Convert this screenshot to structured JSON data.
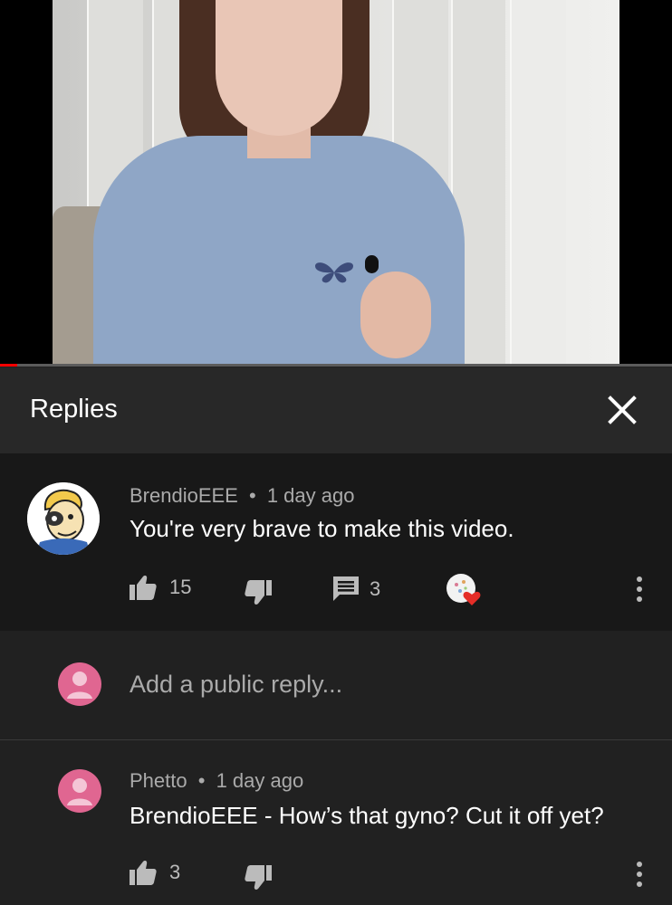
{
  "video": {
    "progress_fraction": 0.025
  },
  "replies_panel": {
    "title": "Replies",
    "close_icon": "close-icon"
  },
  "comment": {
    "author": "BrendioEEE",
    "separator": "•",
    "time": "1 day ago",
    "text": "You're very brave to make this video.",
    "likes": "15",
    "replies_count": "3",
    "icons": [
      "thumbs-up-icon",
      "thumbs-down-icon",
      "comment-icon",
      "creator-heart-icon",
      "more-options-icon"
    ]
  },
  "add_reply": {
    "placeholder": "Add a public reply..."
  },
  "reply": {
    "author": "Phetto",
    "separator": "•",
    "time": "1 day ago",
    "text": "BrendioEEE - How’s that gyno? Cut it off yet?",
    "likes": "3"
  },
  "colors": {
    "background": "#212121",
    "comment_background": "#181818",
    "header_background": "#282828",
    "user_avatar": "#e06691",
    "heart": "#e52d27",
    "progress": "#ff0000"
  }
}
